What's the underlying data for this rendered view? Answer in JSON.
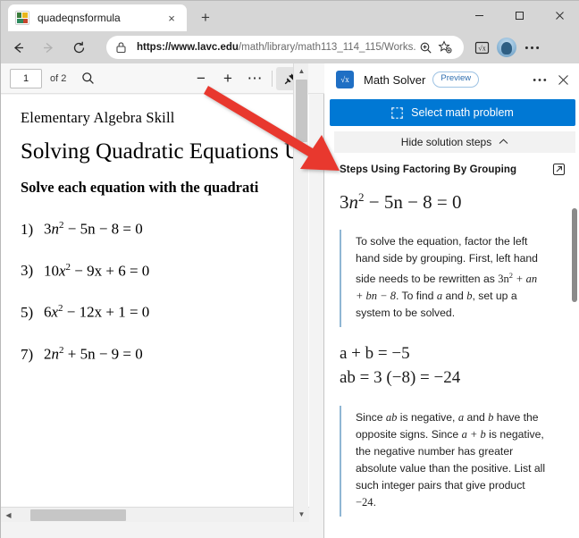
{
  "window": {
    "controls": {
      "minimize": "minimize-icon",
      "maximize": "maximize-icon",
      "close": "close-icon"
    }
  },
  "tab": {
    "title": "quadeqnsformula",
    "favicon": "document-favicon",
    "close_label": "×",
    "new_tab_label": "+"
  },
  "navbar": {
    "back": "←",
    "forward": "→",
    "reload": "⟳",
    "url_bold": "https://www.lavc.edu",
    "url_rest": "/math/library/math113_114_115/Works...",
    "lock_icon": "lock-icon",
    "zoom_icon": "zoom-icon",
    "favorite_icon": "favorite-star-icon",
    "mathsolver_icon": "math-solver-icon",
    "profile_icon": "profile-avatar-icon",
    "settings_icon": "more-settings-icon"
  },
  "pdf_toolbar": {
    "page_value": "1",
    "page_total": "of 2",
    "search_icon": "search-icon",
    "zoom_out": "−",
    "zoom_in": "+",
    "more": "⋯",
    "pin_icon": "pin-icon"
  },
  "document": {
    "kicker": "Elementary Algebra Skill",
    "title": "Solving Quadratic Equations U",
    "subtitle": "Solve each equation with the quadrati",
    "problems": [
      {
        "num": "1)",
        "lhs_coeff": "3",
        "var": "n",
        "exp": "2",
        "rest": " − 5n − 8 = 0"
      },
      {
        "num": "3)",
        "lhs_coeff": "10",
        "var": "x",
        "exp": "2",
        "rest": " − 9x + 6 = 0"
      },
      {
        "num": "5)",
        "lhs_coeff": "6",
        "var": "x",
        "exp": "2",
        "rest": " − 12x + 1 = 0"
      },
      {
        "num": "7)",
        "lhs_coeff": "2",
        "var": "n",
        "exp": "2",
        "rest": " + 5n − 9 = 0"
      }
    ]
  },
  "solver": {
    "title": "Math Solver",
    "preview_badge": "Preview",
    "more_icon": "more-options-icon",
    "close_icon": "close-panel-icon",
    "select_button": "Select math problem",
    "select_button_icon": "marquee-select-icon",
    "select_button_color": "#0078d4",
    "hide_steps": "Hide solution steps",
    "hide_steps_chevron": "⌃",
    "steps_title": "Steps Using Factoring By Grouping",
    "external_link_icon": "external-link-icon",
    "equation": {
      "coeff": "3",
      "var": "n",
      "exp": "2",
      "rest": " − 5n − 8 = 0"
    },
    "note1_part1": "To solve the equation, factor the left hand side by grouping. First, left hand side needs to be rewritten as ",
    "note1_math1": "3n",
    "note1_math1_exp": "2",
    "note1_math1_rest": " + an + bn − 8",
    "note1_part2": ". To find ",
    "note1_a": "a",
    "note1_and": " and ",
    "note1_b": "b",
    "note1_part3": ", set up a system to be solved.",
    "eq_line1": "a + b = −5",
    "eq_line2": "ab = 3 (−8) = −24",
    "note2_p1": "Since ",
    "note2_ab": "ab",
    "note2_p2": " is negative, ",
    "note2_a": "a",
    "note2_p3": " and ",
    "note2_b": "b",
    "note2_p4": " have the opposite signs. Since ",
    "note2_apb": "a + b",
    "note2_p5": " is negative, the negative number has greater absolute value than the positive. List all such integer pairs that give product ",
    "note2_prod": "−24",
    "note2_p6": "."
  },
  "colors": {
    "accent_blue": "#0078d4",
    "annotation_red": "#e8392f",
    "chrome_gray": "#d6d6d6"
  }
}
